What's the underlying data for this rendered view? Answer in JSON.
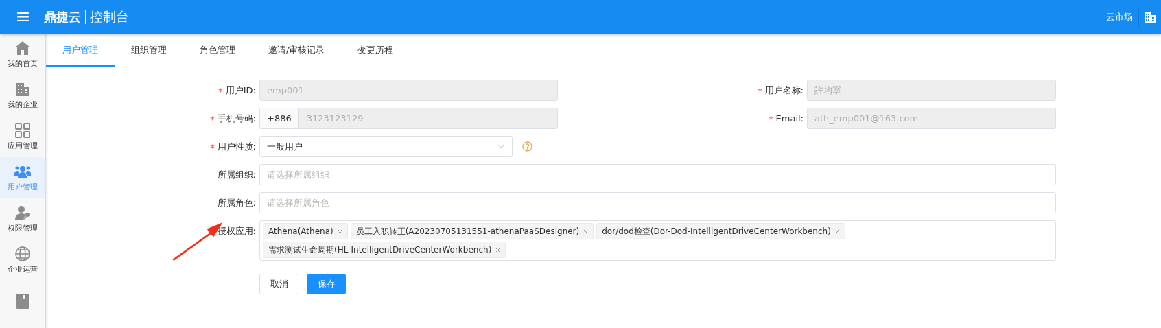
{
  "header": {
    "brand": "鼎捷云",
    "title": "控制台",
    "links": [
      {
        "label": "云市场"
      }
    ]
  },
  "sidebar": {
    "items": [
      {
        "kind": "home",
        "label": "我的首页",
        "selected": false
      },
      {
        "kind": "building",
        "label": "我的企业",
        "selected": false
      },
      {
        "kind": "grid",
        "label": "应用管理",
        "selected": false
      },
      {
        "kind": "users",
        "label": "用户管理",
        "selected": true
      },
      {
        "kind": "user-key",
        "label": "权限管理",
        "selected": false
      },
      {
        "kind": "globe",
        "label": "企业运营",
        "selected": false
      },
      {
        "kind": "book",
        "selected": false
      }
    ]
  },
  "tabs": [
    {
      "label": "用户管理",
      "selected": true
    },
    {
      "label": "组织管理",
      "selected": false
    },
    {
      "label": "角色管理",
      "selected": false
    },
    {
      "label": "邀请/审核记录",
      "selected": false
    },
    {
      "label": "变更历程",
      "selected": false
    }
  ],
  "form": {
    "rows": [
      {
        "fields": [
          {
            "kind": "text",
            "label": "用户ID:",
            "required": true,
            "disabled": true,
            "value": "emp001"
          },
          {
            "kind": "text",
            "label": "用户名称:",
            "required": true,
            "disabled": true,
            "value": "許均寧"
          }
        ]
      },
      {
        "fields": [
          {
            "kind": "phone",
            "label": "手机号码:",
            "required": true,
            "disabled": true,
            "prefix": "+886",
            "value": "3123123129"
          },
          {
            "kind": "text",
            "label": "Email:",
            "required": true,
            "disabled": true,
            "value": "ath_emp001@163.com"
          }
        ]
      },
      {
        "fields": [
          {
            "kind": "select",
            "label": "用户性质:",
            "required": true,
            "disabled": false,
            "value": "一般用户",
            "help": true
          }
        ]
      },
      {
        "fields": [
          {
            "kind": "text",
            "label": "所属组织:",
            "required": false,
            "disabled": false,
            "placeholder": "请选择所属组织"
          }
        ]
      },
      {
        "fields": [
          {
            "kind": "text",
            "label": "所属角色:",
            "required": false,
            "disabled": false,
            "placeholder": "请选择所属角色"
          }
        ]
      },
      {
        "fields": [
          {
            "kind": "tags",
            "label": "授权应用:",
            "required": false,
            "disabled": false,
            "tags": [
              "Athena(Athena)",
              "员工入职转正(A20230705131551-athenaPaaSDesigner)",
              "dor/dod检查(Dor-Dod-IntelligentDriveCenterWorkbench)",
              "需求测试生命周期(HL-IntelligentDriveCenterWorkbench)"
            ]
          }
        ]
      }
    ],
    "buttons": [
      {
        "label": "取消",
        "kind": "default"
      },
      {
        "label": "保存",
        "kind": "primary"
      }
    ]
  }
}
